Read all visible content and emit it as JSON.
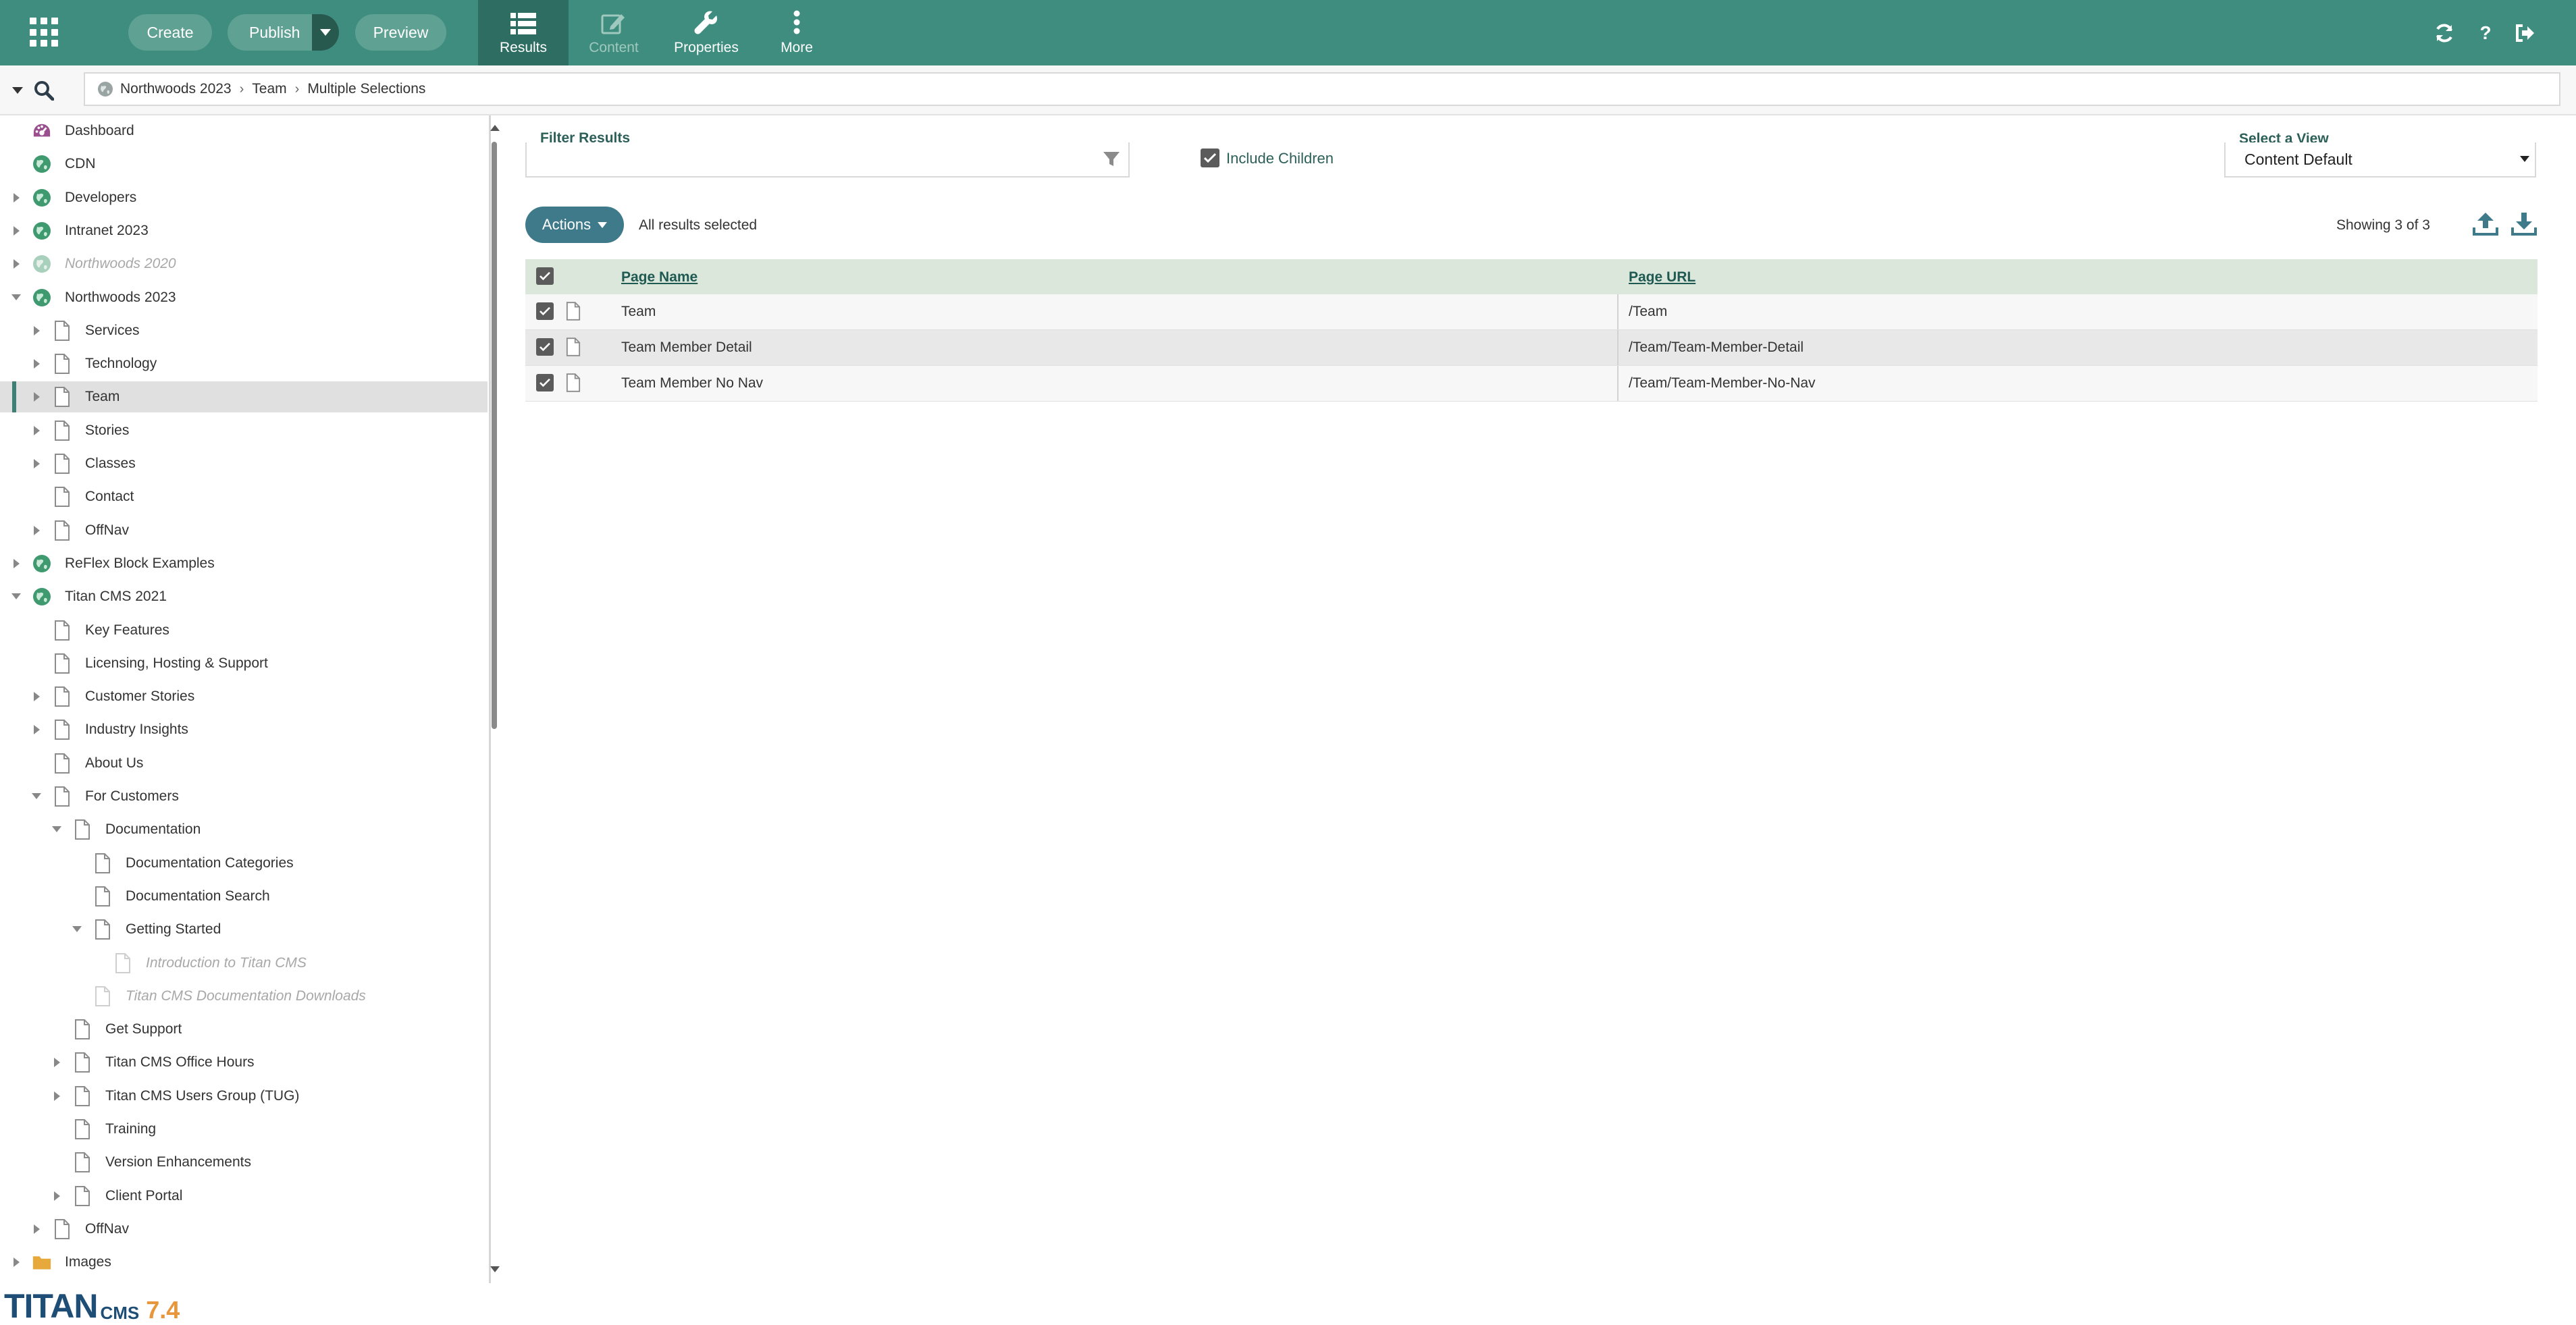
{
  "toolbar": {
    "create_label": "Create",
    "publish_label": "Publish",
    "preview_label": "Preview",
    "tools": [
      {
        "label": "Results",
        "icon": "list-icon",
        "state": "active"
      },
      {
        "label": "Content",
        "icon": "edit-icon",
        "state": "disabled"
      },
      {
        "label": "Properties",
        "icon": "wrench-icon",
        "state": "normal"
      },
      {
        "label": "More",
        "icon": "vertical-dots-icon",
        "state": "normal"
      }
    ],
    "right_icons": [
      "refresh-icon",
      "help-icon",
      "logout-icon"
    ]
  },
  "breadcrumb": [
    "Northwoods 2023",
    "Team",
    "Multiple Selections"
  ],
  "tree": [
    {
      "label": "Dashboard",
      "icon": "dashboard-icon",
      "level": 0,
      "expander": "none",
      "state": "normal"
    },
    {
      "label": "CDN",
      "icon": "globe-icon",
      "level": 0,
      "expander": "none",
      "state": "normal"
    },
    {
      "label": "Developers",
      "icon": "globe-icon",
      "level": 0,
      "expander": "collapsed",
      "state": "normal"
    },
    {
      "label": "Intranet 2023",
      "icon": "globe-icon",
      "level": 0,
      "expander": "collapsed",
      "state": "normal"
    },
    {
      "label": "Northwoods 2020",
      "icon": "globe-icon",
      "level": 0,
      "expander": "collapsed",
      "state": "muted"
    },
    {
      "label": "Northwoods 2023",
      "icon": "globe-icon",
      "level": 0,
      "expander": "expanded",
      "state": "normal"
    },
    {
      "label": "Services",
      "icon": "page-icon",
      "level": 1,
      "expander": "collapsed",
      "state": "normal"
    },
    {
      "label": "Technology",
      "icon": "page-icon",
      "level": 1,
      "expander": "collapsed",
      "state": "normal"
    },
    {
      "label": "Team",
      "icon": "page-icon",
      "level": 1,
      "expander": "collapsed",
      "state": "selected"
    },
    {
      "label": "Stories",
      "icon": "page-icon",
      "level": 1,
      "expander": "collapsed",
      "state": "normal"
    },
    {
      "label": "Classes",
      "icon": "page-icon",
      "level": 1,
      "expander": "collapsed",
      "state": "normal"
    },
    {
      "label": "Contact",
      "icon": "page-icon",
      "level": 1,
      "expander": "none",
      "state": "normal"
    },
    {
      "label": "OffNav",
      "icon": "page-icon",
      "level": 1,
      "expander": "collapsed",
      "state": "normal"
    },
    {
      "label": "ReFlex Block Examples",
      "icon": "globe-icon",
      "level": 0,
      "expander": "collapsed",
      "state": "normal"
    },
    {
      "label": "Titan CMS 2021",
      "icon": "globe-icon",
      "level": 0,
      "expander": "expanded",
      "state": "normal"
    },
    {
      "label": "Key Features",
      "icon": "page-icon",
      "level": 1,
      "expander": "none",
      "state": "normal"
    },
    {
      "label": "Licensing, Hosting & Support",
      "icon": "page-icon",
      "level": 1,
      "expander": "none",
      "state": "normal"
    },
    {
      "label": "Customer Stories",
      "icon": "page-icon",
      "level": 1,
      "expander": "collapsed",
      "state": "normal"
    },
    {
      "label": "Industry Insights",
      "icon": "page-icon",
      "level": 1,
      "expander": "collapsed",
      "state": "normal"
    },
    {
      "label": "About Us",
      "icon": "page-icon",
      "level": 1,
      "expander": "none",
      "state": "normal"
    },
    {
      "label": "For Customers",
      "icon": "page-icon",
      "level": 1,
      "expander": "expanded",
      "state": "normal"
    },
    {
      "label": "Documentation",
      "icon": "page-icon",
      "level": 2,
      "expander": "expanded",
      "state": "normal"
    },
    {
      "label": "Documentation Categories",
      "icon": "page-icon",
      "level": 3,
      "expander": "none",
      "state": "normal"
    },
    {
      "label": "Documentation Search",
      "icon": "page-icon",
      "level": 3,
      "expander": "none",
      "state": "normal"
    },
    {
      "label": "Getting Started",
      "icon": "page-icon",
      "level": 3,
      "expander": "expanded",
      "state": "normal"
    },
    {
      "label": "Introduction to Titan CMS",
      "icon": "page-icon",
      "level": 4,
      "expander": "none",
      "state": "muted"
    },
    {
      "label": "Titan CMS Documentation Downloads",
      "icon": "page-icon",
      "level": 3,
      "expander": "none",
      "state": "muted"
    },
    {
      "label": "Get Support",
      "icon": "page-icon",
      "level": 2,
      "expander": "none",
      "state": "normal"
    },
    {
      "label": "Titan CMS Office Hours",
      "icon": "page-icon",
      "level": 2,
      "expander": "collapsed",
      "state": "normal"
    },
    {
      "label": "Titan CMS Users Group (TUG)",
      "icon": "page-icon",
      "level": 2,
      "expander": "collapsed",
      "state": "normal"
    },
    {
      "label": "Training",
      "icon": "page-icon",
      "level": 2,
      "expander": "none",
      "state": "normal"
    },
    {
      "label": "Version Enhancements",
      "icon": "page-icon",
      "level": 2,
      "expander": "none",
      "state": "normal"
    },
    {
      "label": "Client Portal",
      "icon": "page-icon",
      "level": 2,
      "expander": "collapsed",
      "state": "normal"
    },
    {
      "label": "OffNav",
      "icon": "page-icon",
      "level": 1,
      "expander": "collapsed",
      "state": "normal"
    },
    {
      "label": "Images",
      "icon": "folder-icon",
      "level": 0,
      "expander": "collapsed",
      "state": "normal"
    }
  ],
  "brand": {
    "name": "TITAN",
    "sub": "CMS",
    "version": "7.4"
  },
  "filter": {
    "label": "Filter Results",
    "value": ""
  },
  "include_children": {
    "label": "Include Children",
    "checked": true
  },
  "view": {
    "label": "Select a View",
    "selected": "Content Default"
  },
  "actions": {
    "label": "Actions",
    "status": "All results selected",
    "showing": "Showing 3 of 3"
  },
  "grid": {
    "columns": [
      "Page Name",
      "Page URL"
    ],
    "rows": [
      {
        "name": "Team",
        "url": "/Team",
        "checked": true
      },
      {
        "name": "Team Member Detail",
        "url": "/Team/Team-Member-Detail",
        "checked": true
      },
      {
        "name": "Team Member No Nav",
        "url": "/Team/Team-Member-No-Nav",
        "checked": true
      }
    ]
  },
  "colors": {
    "topbar": "#3f8d7f",
    "active_tool": "#2e6e62",
    "accent_text": "#2b5f58",
    "actions_button": "#3e7a8a",
    "globe": "#3f9a6f",
    "folder": "#e7a93b"
  }
}
